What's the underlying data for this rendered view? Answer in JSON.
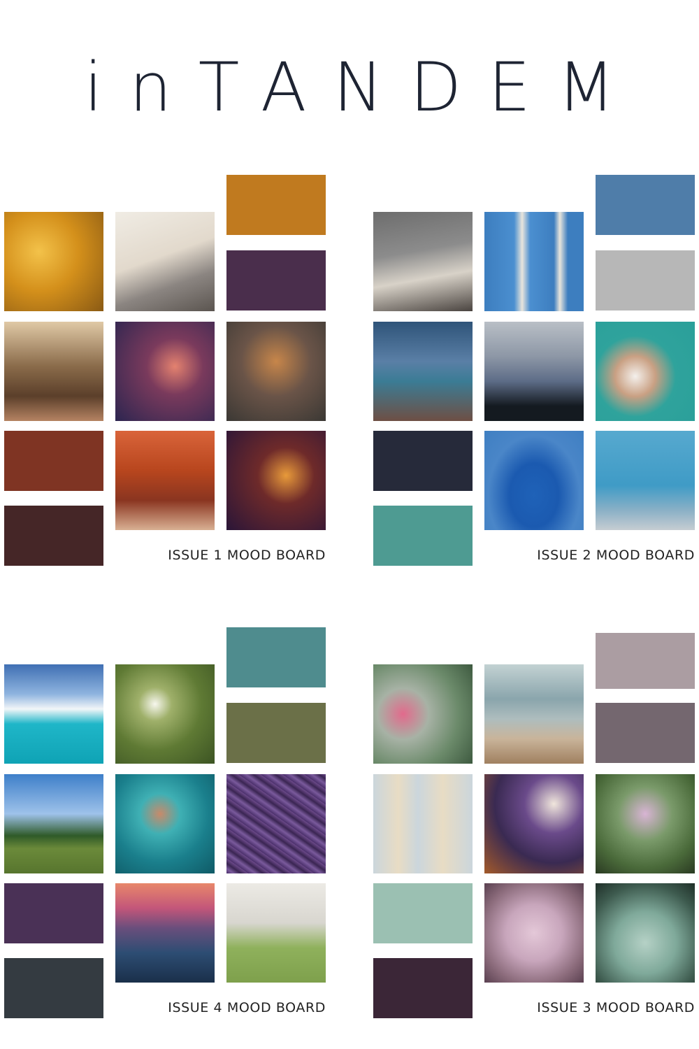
{
  "title": "inTANDEM",
  "boards": [
    {
      "label": "ISSUE 1 MOOD BOARD",
      "swatches": [
        "#c07a1f",
        "#4a2e4c",
        "#7f3423",
        "#452627"
      ],
      "photos": [
        {
          "name": "autumn-leaves-photo",
          "bg": "radial-gradient(circle at 35% 40%, #f3c24a 0%, #d4901b 45%, #8a5a14 100%)"
        },
        {
          "name": "coffee-and-book-photo",
          "bg": "linear-gradient(160deg, #f0ece4 0%, #e2d9cc 45%, #8b8581 70%, #5b5550 100%)"
        },
        {
          "name": "forest-path-photo",
          "bg": "linear-gradient(180deg, #e0c9a6 0%, #8a6b4a 45%, #5b3f2a 75%, #b58362 100%)"
        },
        {
          "name": "falling-leaf-photo",
          "bg": "radial-gradient(circle at 60% 45%, #e4826f 0%, #7a3a5c 35%, #2c2550 100%)"
        },
        {
          "name": "leaf-toss-photo",
          "bg": "radial-gradient(circle at 50% 40%, #c7864a 0%, #6a5448 45%, #3b3834 100%)"
        },
        {
          "name": "red-forest-photo",
          "bg": "linear-gradient(180deg, #d9643a 0%, #b8461e 40%, #8a3520 70%, #d9b093 100%)"
        },
        {
          "name": "bokeh-leaves-photo",
          "bg": "radial-gradient(circle at 60% 45%, #e89a3a 0%, #6e2a2a 35%, #2a1538 100%)"
        }
      ]
    },
    {
      "label": "ISSUE 2 MOOD BOARD",
      "swatches": [
        "#4f7da9",
        "#b7b7b7",
        "#262a3a",
        "#4e9b92"
      ],
      "photos": [
        {
          "name": "cocoa-and-blanket-photo",
          "bg": "linear-gradient(170deg, #6d6d6d 0%, #8c8c8c 40%, #d8d2c8 65%, #4a4440 100%)"
        },
        {
          "name": "birch-branches-photo",
          "bg": "linear-gradient(90deg, #3d7ebf 0%, #4b8fd0 30%, #e9e5dc 38%, #4b8fd0 46%, #3d7ebf 70%, #e9e5dc 76%, #3d7ebf 84%)"
        },
        {
          "name": "blue-mountains-photo",
          "bg": "linear-gradient(180deg, #2f5479 0%, #5a7fa6 40%, #3b7c95 60%, #6e4f44 100%)"
        },
        {
          "name": "misty-hills-photo",
          "bg": "linear-gradient(180deg, #b9bfc6 0%, #8d97a6 35%, #5d6c87 60%, #141a20 85%)"
        },
        {
          "name": "marshmallow-cocoa-photo",
          "bg": "radial-gradient(circle at 40% 55%, #f4f0ec 0%, #c9a083 25%, #2fa39c 50%, #2a9f9a 100%)"
        },
        {
          "name": "woman-blue-sweater-photo",
          "bg": "radial-gradient(ellipse at 50% 65%, #1f62b8 0%, #1b5ab0 35%, #4a86c8 65%, #3f7fc2 100%)"
        },
        {
          "name": "blue-room-chair-photo",
          "bg": "linear-gradient(180deg, #57a9cf 0%, #3f9bc6 55%, #8ab0c6 80%, #c6cdd2 100%)"
        }
      ]
    },
    {
      "label": "ISSUE 4 MOOD BOARD",
      "swatches": [
        "#4f8c8e",
        "#6b7048",
        "#4a3156",
        "#343b41"
      ],
      "photos": [
        {
          "name": "ocean-wave-photo",
          "bg": "linear-gradient(180deg, #3f6fb3 0%, #8fb4df 30%, #f2f6f8 45%, #1fb6c8 60%, #0fa3b5 100%)"
        },
        {
          "name": "daisies-photo",
          "bg": "radial-gradient(circle at 40% 40%, #f7f7ee 0%, #9fb06a 20%, #5f7a34 55%, #3c5423 100%)"
        },
        {
          "name": "green-field-photo",
          "bg": "linear-gradient(180deg, #3e7fc9 0%, #9ec2ea 40%, #2f5a28 62%, #6b8a3a 75%, #57752e 100%)"
        },
        {
          "name": "butterfly-photo",
          "bg": "radial-gradient(circle at 45% 40%, #c88a6a 0%, #3fb0b4 25%, #1a7f8c 60%, #0f5a66 100%)"
        },
        {
          "name": "purple-petals-photo",
          "bg": "repeating-linear-gradient(35deg, #4a2f6a 0px, #7a5a9c 6px, #3a2552 12px, #6c4a8a 18px)"
        },
        {
          "name": "sunset-mountains-photo",
          "bg": "linear-gradient(180deg, #e8876a 0%, #c3567a 25%, #6a4e7c 45%, #2d4d73 70%, #1a2f4a 100%)"
        },
        {
          "name": "woman-knitting-photo",
          "bg": "linear-gradient(180deg, #eceae5 0%, #d8d6cf 40%, #8fb15c 65%, #7ea04c 100%)"
        }
      ]
    },
    {
      "label": "ISSUE 3 MOOD BOARD",
      "swatches": [
        "#ab9da2",
        "#74676f",
        "#9bc0b2",
        "#3b2637"
      ],
      "photos": [
        {
          "name": "pink-zinnia-photo",
          "bg": "radial-gradient(circle at 30% 50%, #e26a8c 0%, #a7b2a5 30%, #6b8a6a 65%, #3e5a40 100%)"
        },
        {
          "name": "misty-mountain-photo",
          "bg": "linear-gradient(180deg, #c3d2d3 0%, #8aa5ac 35%, #aebdbe 55%, #c9b49a 75%, #a08060 100%)"
        },
        {
          "name": "macrame-woman-photo",
          "bg": "linear-gradient(90deg, #cbd6dc 0%, #e8dcc4 25%, #cbd6dc 45%, #e8dcc4 70%, #cbd6dc 100%)"
        },
        {
          "name": "coffee-and-flowers-photo",
          "bg": "radial-gradient(circle at 70% 30%, #f0e6dc 0%, #6a4a8a 30%, #3a2a52 60%, #a45a2a 100%)"
        },
        {
          "name": "chive-flowers-photo",
          "bg": "radial-gradient(circle at 50% 40%, #d8b4d4 0%, #7a9a6a 35%, #4a6a3a 70%, #2a3a22 100%)"
        },
        {
          "name": "cherry-blossom-photo",
          "bg": "radial-gradient(circle at 50% 50%, #e4c8d8 0%, #c8a6bc 40%, #8a6a7a 75%, #5a4050 100%)"
        },
        {
          "name": "dusty-miller-photo",
          "bg": "radial-gradient(circle at 50% 60%, #b5d1c6 0%, #7fa99a 40%, #3d5a4e 75%, #1f2f28 100%)"
        }
      ]
    }
  ]
}
